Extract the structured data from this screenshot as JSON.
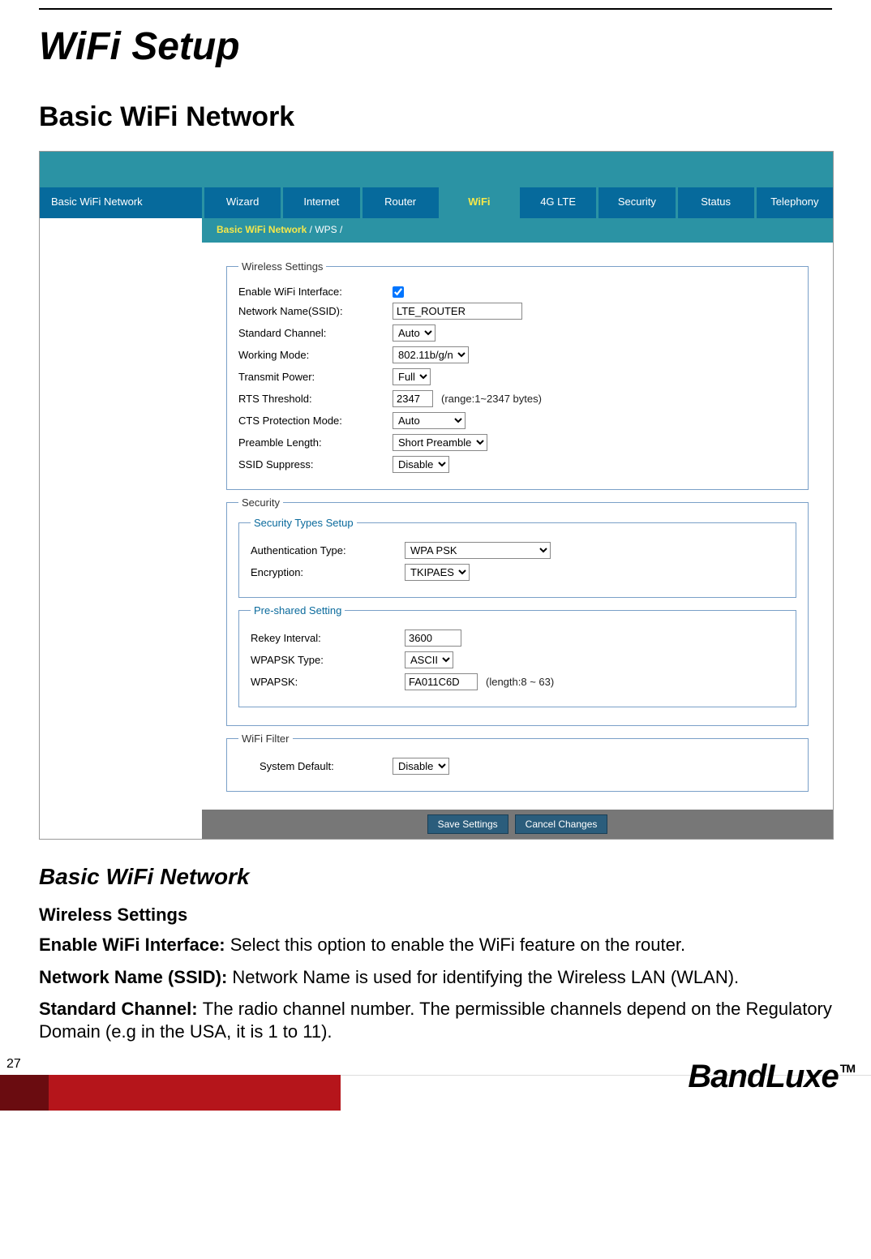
{
  "page": {
    "title_main": "WiFi Setup",
    "title_section": "Basic WiFi Network",
    "page_number": "27",
    "brand": "BandLuxe",
    "brand_tm": "TM"
  },
  "shot": {
    "sidebar_title": "Basic WiFi Network",
    "tabs": [
      "Wizard",
      "Internet",
      "Router",
      "WiFi",
      "4G LTE",
      "Security",
      "Status",
      "Telephony"
    ],
    "active_tab_index": 3,
    "subtabs": {
      "active": "Basic WiFi Network",
      "sep": " / ",
      "other": "WPS",
      "trail": " /"
    },
    "fs_wireless": {
      "legend": "Wireless Settings",
      "enable_label": "Enable WiFi Interface:",
      "enable_checked": true,
      "ssid_label": "Network Name(SSID):",
      "ssid_value": "LTE_ROUTER",
      "channel_label": "Standard Channel:",
      "channel_value": "Auto",
      "mode_label": "Working Mode:",
      "mode_value": "802.11b/g/n",
      "power_label": "Transmit Power:",
      "power_value": "Full",
      "rts_label": "RTS Threshold:",
      "rts_value": "2347",
      "rts_hint": "(range:1~2347 bytes)",
      "cts_label": "CTS Protection Mode:",
      "cts_value": "Auto",
      "preamble_label": "Preamble Length:",
      "preamble_value": "Short Preamble",
      "suppress_label": "SSID Suppress:",
      "suppress_value": "Disable"
    },
    "fs_security": {
      "legend": "Security",
      "types_legend": "Security Types Setup",
      "auth_label": "Authentication Type:",
      "auth_value": "WPA PSK",
      "enc_label": "Encryption:",
      "enc_value": "TKIPAES",
      "psk_legend": "Pre-shared Setting",
      "rekey_label": "Rekey Interval:",
      "rekey_value": "3600",
      "psktype_label": "WPAPSK Type:",
      "psktype_value": "ASCII",
      "psk_label": "WPAPSK:",
      "psk_value": "FA011C6D",
      "psk_hint": "(length:8 ~ 63)"
    },
    "fs_filter": {
      "legend": "WiFi Filter",
      "default_label": "System Default:",
      "default_value": "Disable"
    },
    "buttons": {
      "save": "Save Settings",
      "cancel": "Cancel Changes"
    }
  },
  "body": {
    "subhead": "Basic WiFi Network",
    "h4": "Wireless Settings",
    "p1b": "Enable WiFi Interface: ",
    "p1": "Select this option to enable the WiFi feature on the router.",
    "p2b": "Network Name (SSID): ",
    "p2": "Network Name is used for identifying the Wireless LAN (WLAN).",
    "p3b": "Standard Channel: ",
    "p3": "The radio channel number. The permissible channels depend on the Regulatory Domain (e.g in the USA, it is 1 to 11)."
  }
}
